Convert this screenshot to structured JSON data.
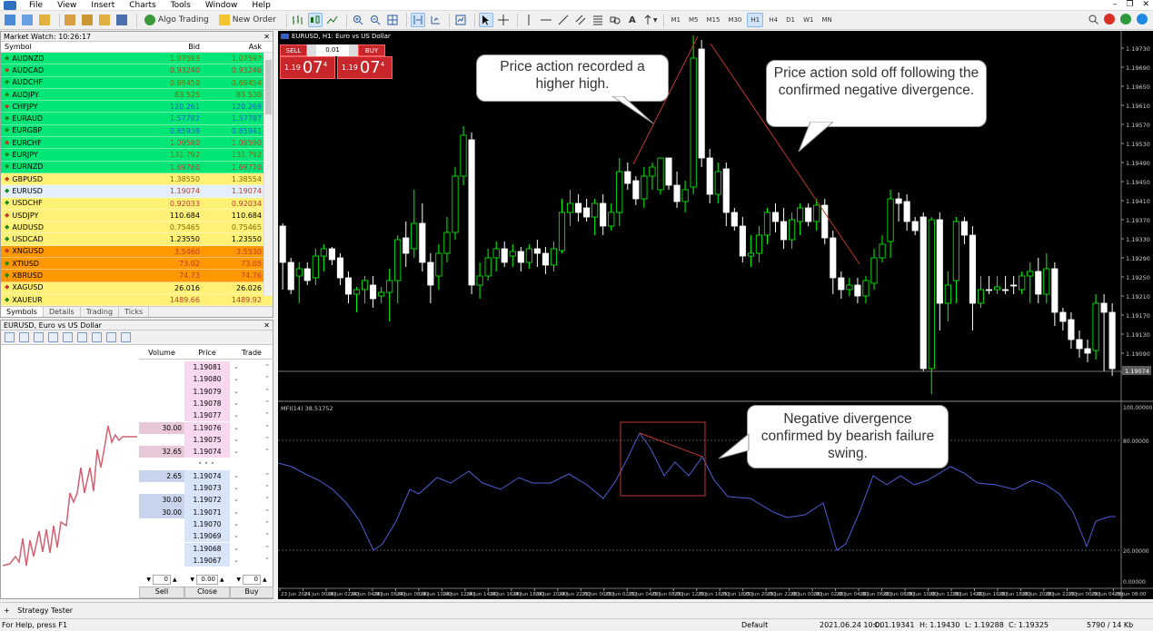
{
  "menu": [
    "File",
    "View",
    "Insert",
    "Charts",
    "Tools",
    "Window",
    "Help"
  ],
  "toolbar": {
    "algo_trading": "Algo Trading",
    "new_order": "New Order",
    "timeframes": [
      "M1",
      "M5",
      "M15",
      "M30",
      "H1",
      "H4",
      "D1",
      "W1",
      "MN"
    ],
    "active_timeframe": "H1"
  },
  "market_watch": {
    "title": "Market Watch: 10:26:17",
    "headers": {
      "symbol": "Symbol",
      "bid": "Bid",
      "ask": "Ask"
    },
    "rows": [
      {
        "symbol": "AUDNZD",
        "bid": "1.07593",
        "ask": "1.07597",
        "bg": "#00e676",
        "color": "#7a6a00"
      },
      {
        "symbol": "AUDCAD",
        "bid": "0.93240",
        "ask": "0.93246",
        "bg": "#00e676",
        "color": "#c0392b"
      },
      {
        "symbol": "AUDCHF",
        "bid": "0.69450",
        "ask": "0.69454",
        "bg": "#00e676",
        "color": "#7a6a00"
      },
      {
        "symbol": "AUDJPY",
        "bid": "83.525",
        "ask": "83.530",
        "bg": "#00e676",
        "color": "#7a6a00"
      },
      {
        "symbol": "CHFJPY",
        "bid": "120.261",
        "ask": "120.269",
        "bg": "#00e676",
        "color": "#1565c0"
      },
      {
        "symbol": "EURAUD",
        "bid": "1.57782",
        "ask": "1.57787",
        "bg": "#00e676",
        "color": "#1565c0"
      },
      {
        "symbol": "EURGBP",
        "bid": "0.85938",
        "ask": "0.85941",
        "bg": "#00e676",
        "color": "#1565c0"
      },
      {
        "symbol": "EURCHF",
        "bid": "1.09580",
        "ask": "1.09590",
        "bg": "#00e676",
        "color": "#c0392b"
      },
      {
        "symbol": "EURJPY",
        "bid": "131.792",
        "ask": "131.792",
        "bg": "#00e676",
        "color": "#7a6a00"
      },
      {
        "symbol": "EURNZD",
        "bid": "1.69760",
        "ask": "1.69770",
        "bg": "#00e676",
        "color": "#c0392b"
      },
      {
        "symbol": "GBPUSD",
        "bid": "1.38550",
        "ask": "1.38554",
        "bg": "#fff176",
        "color": "#7a6a00"
      },
      {
        "symbol": "EURUSD",
        "bid": "1.19074",
        "ask": "1.19074",
        "bg": "#e3f0fb",
        "color": "#c0392b"
      },
      {
        "symbol": "USDCHF",
        "bid": "0.92033",
        "ask": "0.92034",
        "bg": "#fff176",
        "color": "#c0392b"
      },
      {
        "symbol": "USDJPY",
        "bid": "110.684",
        "ask": "110.684",
        "bg": "#fff176",
        "color": "#000000"
      },
      {
        "symbol": "AUDUSD",
        "bid": "0.75465",
        "ask": "0.75465",
        "bg": "#fff176",
        "color": "#7a6a00"
      },
      {
        "symbol": "USDCAD",
        "bid": "1.23550",
        "ask": "1.23550",
        "bg": "#fff176",
        "color": "#000000"
      },
      {
        "symbol": "XNGUSD",
        "bid": "3.5460",
        "ask": "3.5530",
        "bg": "#ff9800",
        "color": "#c0392b"
      },
      {
        "symbol": "XTIUSD",
        "bid": "73.02",
        "ask": "73.05",
        "bg": "#ff9800",
        "color": "#c0392b"
      },
      {
        "symbol": "XBRUSD",
        "bid": "74.73",
        "ask": "74.76",
        "bg": "#ff9800",
        "color": "#c0392b"
      },
      {
        "symbol": "XAGUSD",
        "bid": "26.016",
        "ask": "26.026",
        "bg": "#fff176",
        "color": "#000000"
      },
      {
        "symbol": "XAUEUR",
        "bid": "1489.66",
        "ask": "1489.92",
        "bg": "#fff176",
        "color": "#c0392b"
      }
    ],
    "tabs": [
      "Symbols",
      "Details",
      "Trading",
      "Ticks"
    ]
  },
  "depth": {
    "title": "EURUSD, Euro vs US Dollar",
    "headers": {
      "volume": "Volume",
      "price": "Price",
      "trade": "Trade"
    },
    "asks": [
      {
        "price": "1.19081",
        "volume": ""
      },
      {
        "price": "1.19080",
        "volume": ""
      },
      {
        "price": "1.19079",
        "volume": ""
      },
      {
        "price": "1.19078",
        "volume": ""
      },
      {
        "price": "1.19077",
        "volume": ""
      },
      {
        "price": "1.19076",
        "volume": "30.00"
      },
      {
        "price": "1.19075",
        "volume": ""
      },
      {
        "price": "1.19074",
        "volume": "32.65"
      }
    ],
    "bids": [
      {
        "price": "1.19074",
        "volume": "2.65"
      },
      {
        "price": "1.19073",
        "volume": ""
      },
      {
        "price": "1.19072",
        "volume": "30.00"
      },
      {
        "price": "1.19071",
        "volume": "30.00"
      },
      {
        "price": "1.19070",
        "volume": ""
      },
      {
        "price": "1.19069",
        "volume": ""
      },
      {
        "price": "1.19068",
        "volume": ""
      },
      {
        "price": "1.19067",
        "volume": ""
      }
    ],
    "dots": "• • •",
    "inputs": [
      "0",
      "0.00",
      "0"
    ],
    "buttons": {
      "sell": "Sell",
      "close": "Close",
      "buy": "Buy"
    }
  },
  "chart": {
    "title": "EURUSD, H1:  Euro vs US Dollar",
    "trade_panel": {
      "sell": "SELL",
      "buy": "BUY",
      "lot": "0.01",
      "sell_big": "1.19",
      "sell_main": "07",
      "sell_sup": "4",
      "buy_big": "1.19",
      "buy_main": "07",
      "buy_sup": "4"
    },
    "indicator_label": "MFI(14) 38.51752",
    "price_labels": [
      "1.19730",
      "1.19690",
      "1.19650",
      "1.19610",
      "1.19570",
      "1.19530",
      "1.19490",
      "1.19450",
      "1.19410",
      "1.19370",
      "1.19330",
      "1.19290",
      "1.19250",
      "1.19210",
      "1.19170",
      "1.19130",
      "1.19090",
      "1.19050"
    ],
    "current_price": "1.19074",
    "mfi_labels": [
      "100.00000",
      "80.00000",
      "20.00000",
      "0.00000"
    ],
    "time_labels": [
      "23 Jun 2021",
      "24 Jun 00:00",
      "24 Jun 02:00",
      "24 Jun 04:00",
      "24 Jun 06:00",
      "24 Jun 08:00",
      "24 Jun 10:00",
      "24 Jun 12:00",
      "24 Jun 14:00",
      "24 Jun 16:00",
      "24 Jun 18:00",
      "24 Jun 20:00",
      "24 Jun 22:00",
      "25 Jun 00:00",
      "25 Jun 02:00",
      "25 Jun 04:00",
      "25 Jun 08:00",
      "25 Jun 12:00",
      "25 Jun 16:00",
      "25 Jun 18:00",
      "25 Jun 20:00",
      "25 Jun 22:00",
      "28 Jun 00:00",
      "28 Jun 02:00",
      "28 Jun 04:00",
      "28 Jun 06:00",
      "28 Jun 08:00",
      "28 Jun 10:00",
      "28 Jun 12:00",
      "28 Jun 14:00",
      "28 Jun 16:00",
      "28 Jun 18:00",
      "28 Jun 20:00",
      "28 Jun 22:00",
      "29 Jun 00:00",
      "29 Jun 04:00",
      "29 Jun 08:00"
    ],
    "notes": {
      "higher_high": "Price action recorded a higher high.",
      "sold_off": "Price action sold off following the confirmed negative divergence.",
      "divergence": "Negative divergence confirmed by bearish failure swing."
    }
  },
  "strategy_tester": "Strategy Tester",
  "status": {
    "help": "For Help, press F1",
    "profile": "Default",
    "datetime": "2021.06.24 10:00",
    "open": "O: 1.19341",
    "high": "H: 1.19430",
    "low": "L: 1.19288",
    "close": "C: 1.19325",
    "traffic": "5790 / 14 Kb"
  },
  "colors": {
    "bull": "#00ff00",
    "bear": "#ffffff",
    "mfi": "#4d5fd6",
    "annotation": "#c0392b"
  }
}
